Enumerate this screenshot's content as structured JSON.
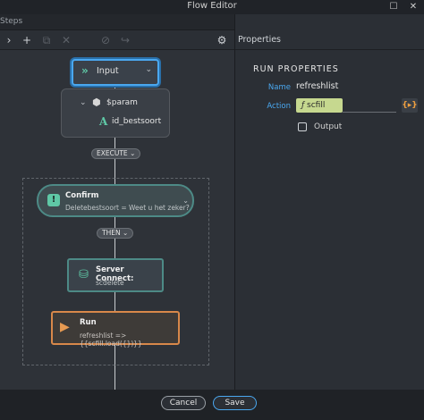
{
  "window": {
    "title": "Flow Editor",
    "controls": {
      "maximize": "☐",
      "close": "✕"
    }
  },
  "steps_panel": {
    "label": "Steps"
  },
  "toolbar": {
    "items": [
      {
        "name": "collapse-icon",
        "glyph": "›"
      },
      {
        "name": "add-icon",
        "glyph": "+"
      },
      {
        "name": "copy-icon",
        "glyph": "⧉"
      },
      {
        "name": "delete-icon",
        "glyph": "✕"
      },
      {
        "name": "disable-icon",
        "glyph": "⊘"
      },
      {
        "name": "export-icon",
        "glyph": "↪"
      },
      {
        "name": "gear-icon",
        "glyph": "⚙"
      }
    ]
  },
  "flow": {
    "input_node": {
      "label": "Input"
    },
    "param": {
      "name": "$param",
      "field": "id_bestsoort"
    },
    "execute_label": "EXECUTE",
    "confirm": {
      "title": "Confirm",
      "subtitle": "Deletebestsoort = Weet u het zeker?"
    },
    "then_label": "THEN",
    "server_connect": {
      "title": "Server Connect:",
      "subtitle": "scdelete"
    },
    "run": {
      "title": "Run",
      "subtitle": "refreshlist => {{scfill.load({})}}"
    }
  },
  "properties": {
    "header": "Properties",
    "section_title": "RUN PROPERTIES",
    "name_label": "Name",
    "name_value": "refreshlist",
    "action_label": "Action",
    "action_value": "scfill",
    "output_label": "Output"
  },
  "footer": {
    "cancel_label": "Cancel",
    "save_label": "Save"
  },
  "colors": {
    "accent": "#4aa8f0",
    "step_border": "#4d8a86",
    "run_border": "#d8884a",
    "icon_green": "#5fc8a6",
    "action_chip": "#c6d88f"
  }
}
